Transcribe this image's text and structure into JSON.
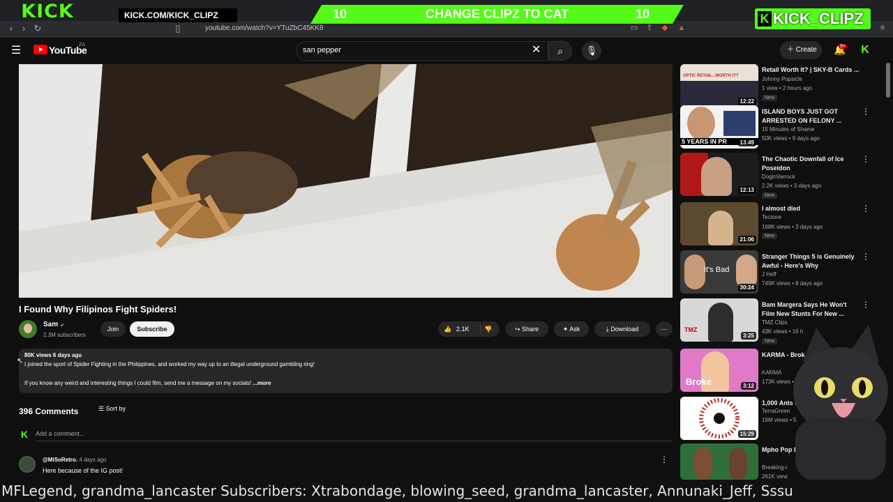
{
  "overlay": {
    "kick_logo": "KICK",
    "kick_url": "KICK.COM/KICK_CLIPZ",
    "banner_left_num": "10",
    "banner_text": "CHANGE CLIPZ TO CAT",
    "banner_right_num": "10",
    "channel_badge": "KICK_CLIPZ",
    "ticker": "MFLegend, grandma_lancaster  Subscribers: Xtrabondage, blowing_seed, grandma_lancaster, Annunaki_Jeff, Sssu"
  },
  "browser": {
    "url": "youtube.com/watch?v=YTuZbC45KK8"
  },
  "header": {
    "logo_text": "YouTube",
    "country_code": "ZA",
    "search_value": "san pepper",
    "create_label": "Create",
    "notif_count": "9+"
  },
  "video": {
    "title": "I Found Why Filipinos Fight Spiders!",
    "channel": "Sam",
    "subscribers": "2.3M subscribers",
    "join_label": "Join",
    "subscribe_label": "Subscribe",
    "likes": "2.1K",
    "share_label": "Share",
    "ask_label": "Ask",
    "download_label": "Download"
  },
  "description": {
    "meta": "80K views  6 days ago",
    "line1": "I joined the sport of Spider Fighting in the Philippines, and worked my way up to an illegal underground gambling ring!",
    "line2": "If you know any weird and interesting things I could film, send me a message on my socials! ",
    "more": "...more"
  },
  "comments": {
    "count": "396 Comments",
    "sort_label": "Sort by",
    "add_placeholder": "Add a comment...",
    "items": [
      {
        "user": "@MiSoRetro.",
        "time": "4 days ago",
        "text": "Here because of the IG post!"
      }
    ]
  },
  "sidebar": {
    "items": [
      {
        "title": "Retail Worth It? | SKY-B Cards ...",
        "channel": "Johnny Popsicle",
        "meta": "1 view • 2 hours ago",
        "duration": "12:22",
        "new": "New",
        "thumb_text": "OPTIC RETAIL...WORTH IT?"
      },
      {
        "title": "ISLAND BOYS JUST GOT ARRESTED ON FELONY ...",
        "channel": "15 Minutes of Shame",
        "meta": "50K views • 9 days ago",
        "duration": "13:49",
        "new": "",
        "thumb_text": "5 YEARS IN PR"
      },
      {
        "title": "The Chaotic Downfall of Ice Poseidon",
        "channel": "DoginVarrock",
        "meta": "2.2K views • 3 days ago",
        "duration": "12:13",
        "new": "New",
        "thumb_text": ""
      },
      {
        "title": "I almost died",
        "channel": "Tectone",
        "meta": "168K views • 3 days ago",
        "duration": "21:06",
        "new": "New",
        "thumb_text": ""
      },
      {
        "title": "Stranger Things 5 is Genuinely Awful - Here's Why",
        "channel": "J Heff",
        "meta": "749K views • 8 days ago",
        "duration": "30:24",
        "new": "",
        "thumb_text": "It's Bad"
      },
      {
        "title": "Bam Margera Says He Won't Film New Stunts For New ...",
        "channel": "TMZ Clips",
        "meta": "43K views • 16 h",
        "duration": "3:25",
        "new": "New",
        "thumb_text": "TMZ"
      },
      {
        "title": "KARMA - Brok TEMMORA) (O",
        "channel": "KARMA",
        "meta": "173K views • 2",
        "duration": "3:12",
        "new": "",
        "thumb_text": "Broke"
      },
      {
        "title": "1,000 Ants w",
        "channel": "TerraGreen",
        "meta": "19M views • 5",
        "duration": "15:29",
        "new": "",
        "thumb_text": ""
      },
      {
        "title": "Mpho Pop Experienc",
        "channel": "Breaking-i",
        "meta": "261K view",
        "duration": "",
        "new": "",
        "thumb_text": ""
      }
    ]
  },
  "colors": {
    "kick_green": "#53fc18",
    "yt_red": "#ff0000",
    "bg": "#0f0f0f"
  }
}
